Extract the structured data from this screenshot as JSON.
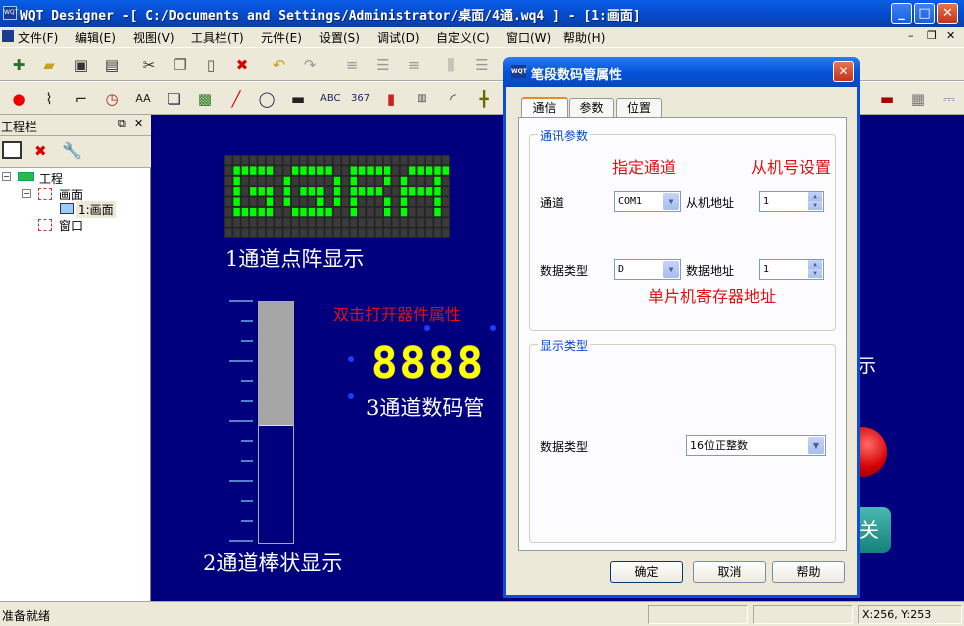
{
  "window": {
    "title": "WQT Designer -[ C:/Documents and Settings/Administrator/桌面/4通.wq4 ] - [1:画面]",
    "logo": "WQT"
  },
  "menu": [
    "文件(F)",
    "编辑(E)",
    "视图(V)",
    "工具栏(T)",
    "元件(E)",
    "设置(S)",
    "调试(D)",
    "自定义(C)",
    "窗口(W)",
    "帮助(H)"
  ],
  "panel": {
    "title": "工程栏",
    "tree": {
      "root": "工程",
      "screen": "画面",
      "page": "1:画面",
      "window": "窗口"
    }
  },
  "canvas": {
    "dotmatrix_label": "1通道点阵显示",
    "bar_label": "2通道棒状显示",
    "annotation": "双击打开器件属性",
    "seg_value": "8888",
    "seg_label": "3通道数码管",
    "right_partial_text": "示",
    "right_partial_button": "关",
    "bar_fill": 0.49
  },
  "dialog": {
    "logo": "WQT",
    "title": "笔段数码管属性",
    "tabs": [
      "通信",
      "参数",
      "位置"
    ],
    "comm_group": "通讯参数",
    "note_channel": "指定通道",
    "note_slave": "从机号设置",
    "note_register": "单片机寄存器地址",
    "channel_label": "通道",
    "channel_value": "COM1",
    "slave_label": "从机地址",
    "slave_value": "1",
    "dtype_label": "数据类型",
    "dtype_value": "D",
    "daddr_label": "数据地址",
    "daddr_value": "1",
    "display_group": "显示类型",
    "display_dtype_label": "数据类型",
    "display_dtype_value": "16位正整数",
    "ok": "确定",
    "cancel": "取消",
    "help": "帮助"
  },
  "status": {
    "ready": "准备就绪",
    "coords": "X:256, Y:253"
  },
  "colors": {
    "canvas": "#00007e",
    "seg": "#ffff00",
    "dot_on": "#00ff00",
    "note": "#dd1111"
  }
}
